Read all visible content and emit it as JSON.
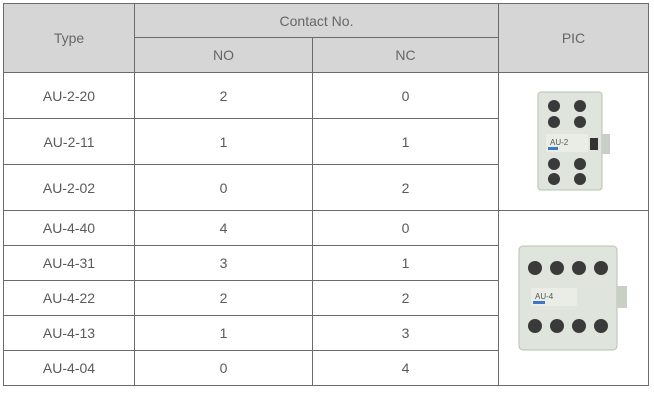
{
  "table": {
    "header": {
      "type": "Type",
      "contact_no": "Contact No.",
      "no": "NO",
      "nc": "NC",
      "pic": "PIC"
    },
    "groups": [
      {
        "product_label": "AU-2",
        "rows": [
          {
            "type": "AU-2-20",
            "no": "2",
            "nc": "0"
          },
          {
            "type": "AU-2-11",
            "no": "1",
            "nc": "1"
          },
          {
            "type": "AU-2-02",
            "no": "0",
            "nc": "2"
          }
        ]
      },
      {
        "product_label": "AU-4",
        "rows": [
          {
            "type": "AU-4-40",
            "no": "4",
            "nc": "0"
          },
          {
            "type": "AU-4-31",
            "no": "3",
            "nc": "1"
          },
          {
            "type": "AU-4-22",
            "no": "2",
            "nc": "2"
          },
          {
            "type": "AU-4-13",
            "no": "1",
            "nc": "3"
          },
          {
            "type": "AU-4-04",
            "no": "0",
            "nc": "4"
          }
        ]
      }
    ]
  },
  "colors": {
    "header_bg": "#d6d6d6",
    "border": "#6b6b6b",
    "text": "#5a5a5a",
    "device_body": "#dfe5dc"
  }
}
